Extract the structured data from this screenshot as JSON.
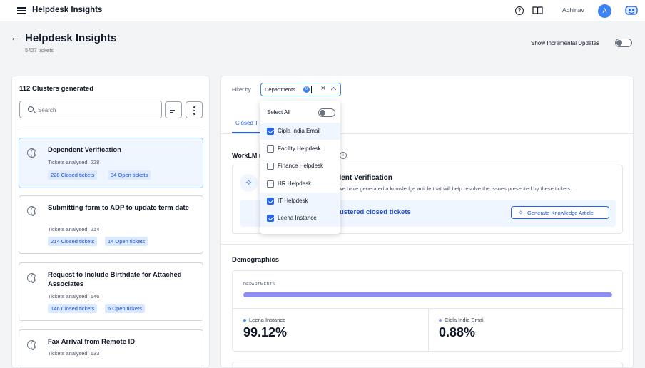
{
  "header": {
    "app_title": "Helpdesk Insights",
    "user_name": "Abhinav",
    "avatar_initial": "A",
    "icons": [
      "menu-icon",
      "help-icon",
      "book-icon",
      "bot-icon"
    ]
  },
  "page": {
    "title": "Helpdesk Insights",
    "ticket_count": "5427 tickets",
    "incremental_label": "Show Incremental Updates",
    "incremental_on": false
  },
  "clusters": {
    "heading": "112 Clusters generated",
    "search_placeholder": "Search",
    "items": [
      {
        "title": "Dependent Verification",
        "analysed": "Tickets analysed: 228",
        "closed": "228 Closed tickets",
        "open": "34 Open tickets",
        "selected": true
      },
      {
        "title": "Submitting form to ADP to update term date",
        "analysed": "Tickets analysed: 214",
        "closed": "214 Closed tickets",
        "open": "14 Open tickets",
        "selected": false
      },
      {
        "title": "Request to Include Birthdate for Attached Associates",
        "analysed": "Tickets analysed: 146",
        "closed": "146 Closed tickets",
        "open": "6 Open tickets",
        "selected": false
      },
      {
        "title": "Fax Arrival from Remote ID",
        "analysed": "Tickets analysed: 133",
        "selected": false
      }
    ]
  },
  "filter": {
    "label": "Filter by",
    "value": "Departments",
    "count": "6",
    "select_all": "Select All",
    "select_all_on": false,
    "options": [
      {
        "label": "Cipla India Email",
        "checked": true
      },
      {
        "label": "Facility Helpdesk",
        "checked": false
      },
      {
        "label": "Finance Helpdesk",
        "checked": false
      },
      {
        "label": "HR Helpdesk",
        "checked": false
      },
      {
        "label": "IT Helpdesk",
        "checked": true
      },
      {
        "label": "Leena Instance",
        "checked": true
      }
    ]
  },
  "tabs": {
    "closed": "Closed T"
  },
  "worklm": {
    "label": "WorkLM r",
    "kb_title": "ndent Verification",
    "kb_desc": "d, we have generated a knowledge article that will help resolve the issues presented by these tickets.",
    "clustered": "ustered closed tickets",
    "generate_button": "Generate Knowledge Article"
  },
  "demographics": {
    "title": "Demographics",
    "dept_label": "DEPARTMENTS",
    "bar_fill_fraction": 1.0,
    "stats": [
      {
        "label": "Leena Instance",
        "value": "99.12%",
        "color": "#3b82f6"
      },
      {
        "label": "Cipla India Email",
        "value": "0.88%",
        "color": "#8b8ef0"
      }
    ]
  },
  "colors": {
    "accent": "#2563eb",
    "selected_bg": "#eff6ff",
    "bar": "#8b8ef0"
  }
}
